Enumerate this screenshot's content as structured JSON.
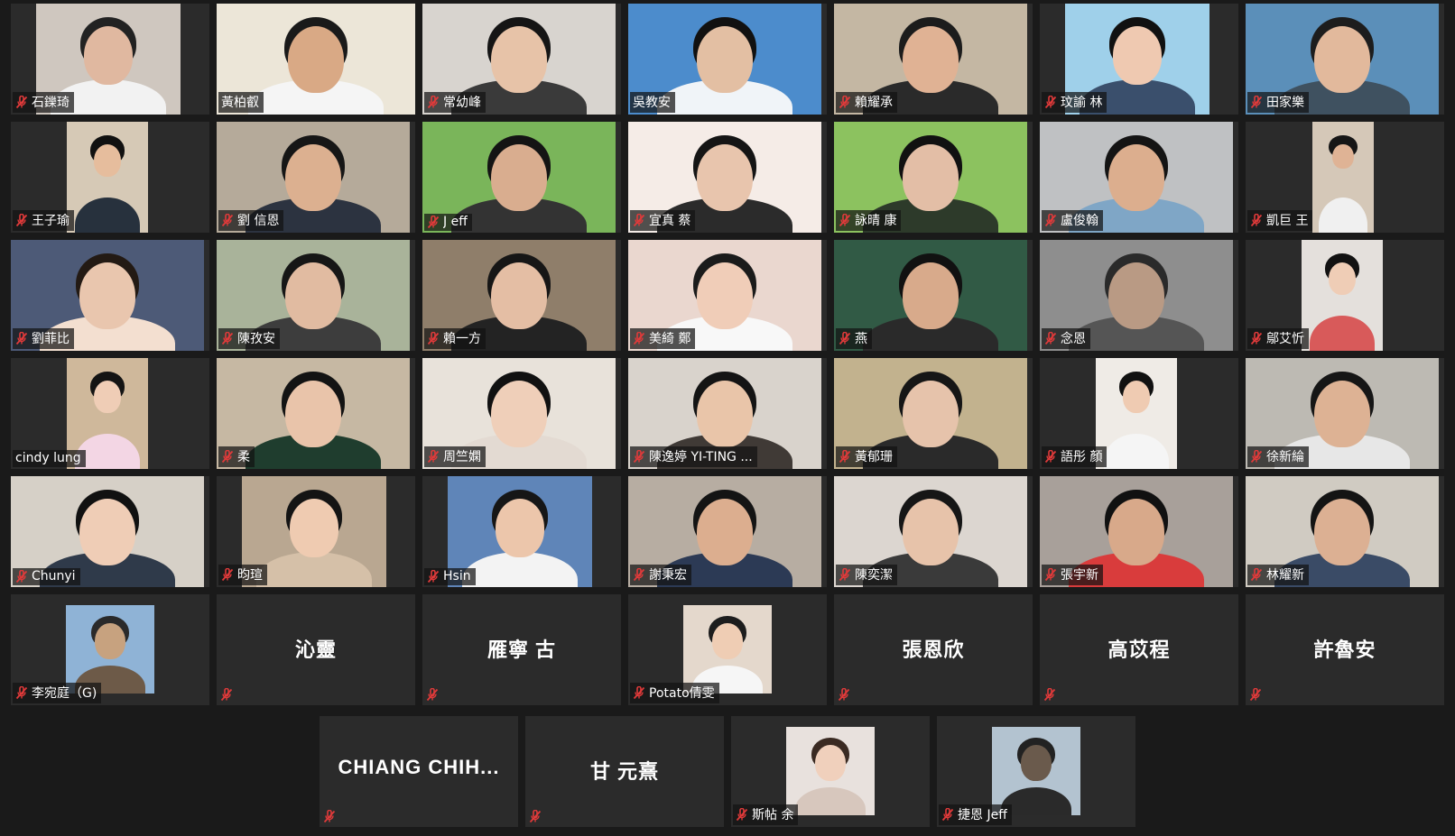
{
  "participants": [
    {
      "name": "石鑠琦",
      "muted": true,
      "bg": "#cfc7bf",
      "skin": "#e0b8a0",
      "shirt": "#f2f2f2",
      "hair": "#222",
      "vw": 160,
      "vx": 28
    },
    {
      "name": "黃柏叡",
      "muted": false,
      "active": true,
      "bg": "#ece6d8",
      "skin": "#d9a985",
      "shirt": "#f5f5f5",
      "hair": "#1a1a1a",
      "vw": 220,
      "vx": 0
    },
    {
      "name": "常幼峰",
      "muted": true,
      "bg": "#d8d4cf",
      "skin": "#e7c3a8",
      "shirt": "#3a3a3a",
      "hair": "#151515",
      "vw": 214,
      "vx": 0
    },
    {
      "name": "吳教安",
      "muted": false,
      "bg": "#4c8ccc",
      "skin": "#e3bfa3",
      "shirt": "#f0f4f8",
      "hair": "#111",
      "vw": 214,
      "vx": 0
    },
    {
      "name": "賴耀承",
      "muted": true,
      "bg": "#c4b7a3",
      "skin": "#e0b294",
      "shirt": "#2a2a2a",
      "hair": "#1c1c1c",
      "vw": 214,
      "vx": 0
    },
    {
      "name": "玟諭 林",
      "muted": true,
      "bg": "#9fd0ea",
      "skin": "#efc9b1",
      "shirt": "#3a4f6c",
      "hair": "#111",
      "vw": 160,
      "vx": 28
    },
    {
      "name": "田家樂",
      "muted": true,
      "bg": "#5b8fb9",
      "skin": "#e2b99c",
      "shirt": "#3f5160",
      "hair": "#1d1d1d",
      "vw": 214,
      "vx": 0
    },
    {
      "name": "王子瑜",
      "muted": true,
      "bg": "#d6c9b6",
      "skin": "#e6bd9d",
      "shirt": "#27313d",
      "hair": "#111",
      "vw": 90,
      "vx": 62
    },
    {
      "name": "劉 信恩",
      "muted": true,
      "bg": "#b5aa9a",
      "skin": "#dcb090",
      "shirt": "#2c3340",
      "hair": "#161616",
      "vw": 214,
      "vx": 0
    },
    {
      "name": "J eff",
      "muted": true,
      "bg": "#7ab55a",
      "skin": "#d9ad8f",
      "shirt": "#333",
      "hair": "#141414",
      "vw": 214,
      "vx": 0
    },
    {
      "name": "宜真 蔡",
      "muted": true,
      "bg": "#f5ece7",
      "skin": "#e8c5ad",
      "shirt": "#2b2b2b",
      "hair": "#151515",
      "vw": 214,
      "vx": 0
    },
    {
      "name": "詠晴 康",
      "muted": true,
      "bg": "#8cc25f",
      "skin": "#e3bea6",
      "shirt": "#2d3a2a",
      "hair": "#111",
      "vw": 214,
      "vx": 0
    },
    {
      "name": "盧俊翰",
      "muted": true,
      "bg": "#bfc1c3",
      "skin": "#dcae8e",
      "shirt": "#7fa6c6",
      "hair": "#141414",
      "vw": 214,
      "vx": 0
    },
    {
      "name": "凱巨 王",
      "muted": true,
      "bg": "#d5c8b8",
      "skin": "#dfb395",
      "shirt": "#f0f0f0",
      "hair": "#161616",
      "vw": 68,
      "vx": 74
    },
    {
      "name": "劉菲比",
      "muted": true,
      "bg": "#4d5a77",
      "skin": "#e9c6ae",
      "shirt": "#f3dfd0",
      "hair": "#231a14",
      "vw": 214,
      "vx": 0
    },
    {
      "name": "陳孜安",
      "muted": true,
      "bg": "#a9b39a",
      "skin": "#e1bba1",
      "shirt": "#3d3d3d",
      "hair": "#161616",
      "vw": 214,
      "vx": 0
    },
    {
      "name": "賴一方",
      "muted": true,
      "bg": "#8f7e6a",
      "skin": "#e4bea4",
      "shirt": "#232323",
      "hair": "#161616",
      "vw": 214,
      "vx": 0
    },
    {
      "name": "美綺 鄭",
      "muted": true,
      "bg": "#ead7cf",
      "skin": "#f0cdb8",
      "shirt": "#f8f8f8",
      "hair": "#1b1b1b",
      "vw": 214,
      "vx": 0
    },
    {
      "name": "燕",
      "muted": true,
      "bg": "#315a45",
      "skin": "#d8aa8b",
      "shirt": "#2a2a2a",
      "hair": "#111",
      "vw": 214,
      "vx": 0
    },
    {
      "name": "念恩",
      "muted": true,
      "bg": "#8e8e8e",
      "skin": "#b99a84",
      "shirt": "#555",
      "hair": "#2a2a2a",
      "vw": 214,
      "vx": 0
    },
    {
      "name": "鄔艾忻",
      "muted": true,
      "bg": "#e4e0dc",
      "skin": "#efcdb6",
      "shirt": "#d85a5a",
      "hair": "#121212",
      "vw": 90,
      "vx": 62
    },
    {
      "name": "cindy lung",
      "muted": false,
      "bg": "#cfb89b",
      "skin": "#efcdb6",
      "shirt": "#f3d6e4",
      "hair": "#141414",
      "vw": 90,
      "vx": 62
    },
    {
      "name": "柔",
      "muted": true,
      "bg": "#c6b8a3",
      "skin": "#e9c4aa",
      "shirt": "#1f3d2e",
      "hair": "#131313",
      "vw": 214,
      "vx": 0
    },
    {
      "name": "周竺嫻",
      "muted": true,
      "bg": "#e8e2da",
      "skin": "#efcfb9",
      "shirt": "#e3dad2",
      "hair": "#111",
      "vw": 214,
      "vx": 0
    },
    {
      "name": "陳逸婷 YI-TING ...",
      "muted": true,
      "bg": "#d9d3cc",
      "skin": "#e9c5a9",
      "shirt": "#403a36",
      "hair": "#141414",
      "vw": 214,
      "vx": 0
    },
    {
      "name": "黃郁珊",
      "muted": true,
      "bg": "#c2b28e",
      "skin": "#e6c3ab",
      "shirt": "#2a2a2a",
      "hair": "#161616",
      "vw": 214,
      "vx": 0
    },
    {
      "name": "語彤 顏",
      "muted": true,
      "bg": "#efebe6",
      "skin": "#efcbb2",
      "shirt": "#f5f5f5",
      "hair": "#111",
      "vw": 90,
      "vx": 62
    },
    {
      "name": "徐新綸",
      "muted": true,
      "bg": "#bdbab3",
      "skin": "#ddb294",
      "shirt": "#e7e7e7",
      "hair": "#161616",
      "vw": 214,
      "vx": 0
    },
    {
      "name": "Chunyi",
      "muted": true,
      "bg": "#d6d0c7",
      "skin": "#efcdb6",
      "shirt": "#2f3a4a",
      "hair": "#111",
      "vw": 214,
      "vx": 0
    },
    {
      "name": "昀瑄",
      "muted": true,
      "bg": "#b9a791",
      "skin": "#efcbb1",
      "shirt": "#d5c0a8",
      "hair": "#141414",
      "vw": 160,
      "vx": 28
    },
    {
      "name": "Hsin",
      "muted": true,
      "bg": "#5f85b8",
      "skin": "#ecc6ab",
      "shirt": "#f3f3f3",
      "hair": "#161616",
      "vw": 160,
      "vx": 28
    },
    {
      "name": "謝秉宏",
      "muted": true,
      "bg": "#b7ada2",
      "skin": "#dcae8f",
      "shirt": "#2c3a55",
      "hair": "#141414",
      "vw": 214,
      "vx": 0
    },
    {
      "name": "陳奕潔",
      "muted": true,
      "bg": "#dcd6d0",
      "skin": "#e7c3aa",
      "shirt": "#3a3a3a",
      "hair": "#161616",
      "vw": 214,
      "vx": 0
    },
    {
      "name": "張宇新",
      "muted": true,
      "bg": "#a8a09a",
      "skin": "#d8a98a",
      "shirt": "#d93c3c",
      "hair": "#111",
      "vw": 214,
      "vx": 0
    },
    {
      "name": "林耀新",
      "muted": true,
      "bg": "#d0cbc2",
      "skin": "#dcb093",
      "shirt": "#3a4b66",
      "hair": "#141414",
      "vw": 214,
      "vx": 0
    },
    {
      "name": "李宛庭（G)",
      "muted": true,
      "avatar": true,
      "bg": "#8fb3d6",
      "skin": "#c7a27f",
      "shirt": "#6d5a48",
      "hair": "#2a2a2a",
      "vw": 98
    },
    {
      "name": "",
      "center": "沁靈",
      "muted": true
    },
    {
      "name": "",
      "center": "雁寧 古",
      "muted": true
    },
    {
      "name": "Potato倩雯",
      "muted": true,
      "avatar": true,
      "bg": "#e4d8cc",
      "skin": "#efcdb4",
      "shirt": "#f6f6f6",
      "hair": "#1d1d1d",
      "vw": 98
    },
    {
      "name": "",
      "center": "張恩欣",
      "muted": true
    },
    {
      "name": "",
      "center": "高苡程",
      "muted": true
    },
    {
      "name": "",
      "center": "許魯安",
      "muted": true
    }
  ],
  "bottom_row": [
    {
      "name": "",
      "center": "CHIANG CHIH...",
      "muted": true
    },
    {
      "name": "",
      "center": "甘 元熹",
      "muted": true
    },
    {
      "name": "斯帖 余",
      "muted": true,
      "avatar": true,
      "bg": "#e8e1dd",
      "skin": "#f0d0bc",
      "shirt": "#d7c7bd",
      "hair": "#3a2a22",
      "vw": 98
    },
    {
      "name": "捷恩 Jeff",
      "muted": true,
      "avatar": true,
      "bg": "#b3c3d0",
      "skin": "#6a5a4c",
      "shirt": "#2a2a2a",
      "hair": "#222",
      "vw": 98
    }
  ],
  "icons": {
    "mute": "microphone-muted-icon"
  },
  "colors": {
    "active_border": "#c8e02a",
    "mute_red": "#e03a3a",
    "tile_bg": "#2b2b2b",
    "page_bg": "#1a1a1a"
  }
}
